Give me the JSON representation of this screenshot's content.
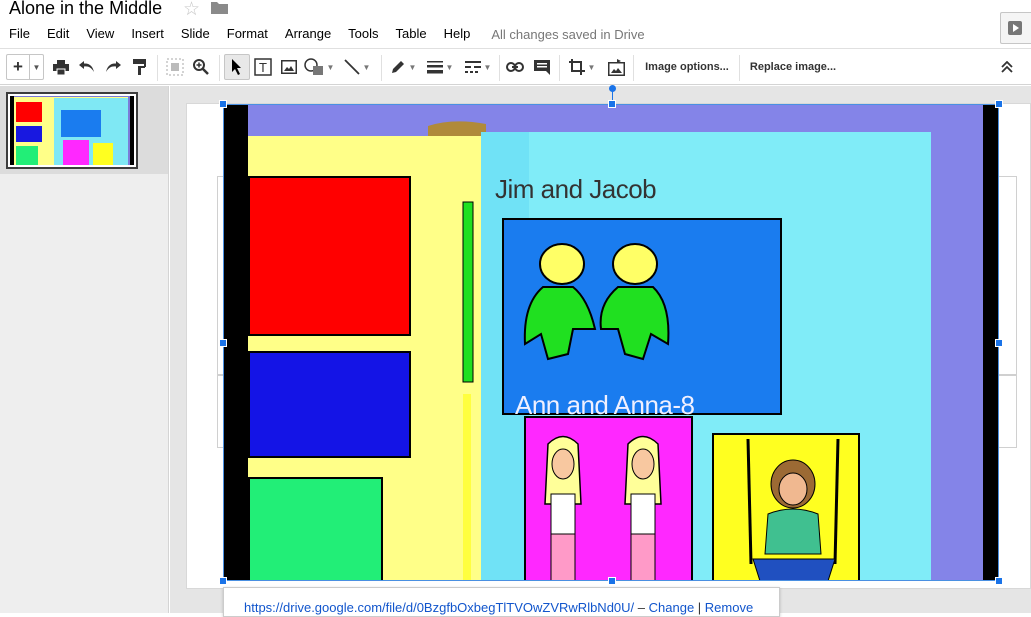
{
  "title": "Alone in the Middle",
  "menu": [
    "File",
    "Edit",
    "View",
    "Insert",
    "Slide",
    "Format",
    "Arrange",
    "Tools",
    "Table",
    "Help"
  ],
  "save_status": "All changes saved in Drive",
  "toolbar": {
    "image_options": "Image options...",
    "replace_image": "Replace image..."
  },
  "slide": {
    "image_text_1": "Jim and Jacob",
    "image_text_2": "Ann and Anna-8"
  },
  "link_bubble": {
    "url": "https://drive.google.com/file/d/0BzgfbOxbegTlTVOwZVRwRlbNd0U/",
    "dash": " – ",
    "change": "Change",
    "pipe": " | ",
    "remove": "Remove"
  },
  "colors": {
    "accent": "#1a73e8",
    "image_bg": "#8484e8"
  },
  "icons": [
    "star-icon",
    "folder-icon",
    "present-icon",
    "print-icon",
    "undo-icon",
    "redo-icon",
    "paint-format-icon",
    "zoom-fit-icon",
    "zoom-icon",
    "select-icon",
    "textbox-icon",
    "image-icon",
    "shape-icon",
    "line-icon",
    "pen-icon",
    "line-weight-icon",
    "line-dash-icon",
    "link-icon",
    "comment-icon",
    "crop-icon",
    "reset-image-icon",
    "collapse-icon"
  ]
}
